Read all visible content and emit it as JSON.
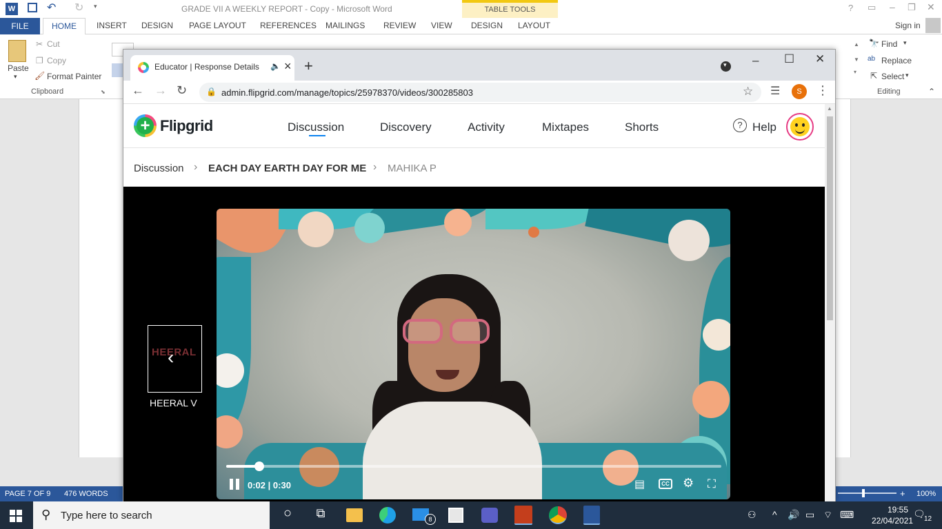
{
  "word": {
    "title": "GRADE VII A WEEKLY REPORT - Copy - Microsoft Word",
    "table_tools": "TABLE TOOLS",
    "tabs": [
      "FILE",
      "HOME",
      "INSERT",
      "DESIGN",
      "PAGE LAYOUT",
      "REFERENCES",
      "MAILINGS",
      "REVIEW",
      "VIEW",
      "DESIGN",
      "LAYOUT"
    ],
    "sign_in": "Sign in",
    "clipboard": {
      "paste": "Paste",
      "cut": "Cut",
      "copy": "Copy",
      "format_painter": "Format Painter",
      "group": "Clipboard"
    },
    "editing": {
      "find": "Find",
      "replace": "Replace",
      "select": "Select",
      "group": "Editing"
    },
    "status": {
      "page": "PAGE 7 OF 9",
      "words": "476 WORDS",
      "zoom": "100%"
    }
  },
  "chrome": {
    "tab_title": "Educator | Response Details",
    "url": "admin.flipgrid.com/manage/topics/25978370/videos/300285803",
    "profile_initial": "S"
  },
  "flipgrid": {
    "logo": "Flipgrid",
    "nav": [
      "Discussion",
      "Discovery",
      "Activity",
      "Mixtapes",
      "Shorts"
    ],
    "help": "Help",
    "breadcrumb": [
      "Discussion",
      "EACH DAY EARTH DAY FOR ME",
      "MAHIKA P"
    ],
    "video": {
      "current": "0:02",
      "duration": "0:30",
      "progress": 0.0667
    },
    "prev_response": {
      "name": "HEERAL V",
      "thumb_text": "HEERAL"
    }
  },
  "taskbar": {
    "search_placeholder": "Type here to search",
    "mail_badge": "8",
    "time": "19:55",
    "date": "22/04/2021",
    "notifications": "12"
  },
  "colors": {
    "word_blue": "#2b579a",
    "flipgrid_green": "#21b04b",
    "accent_blue": "#0a82f0",
    "taskbar": "#1f2d3d"
  }
}
